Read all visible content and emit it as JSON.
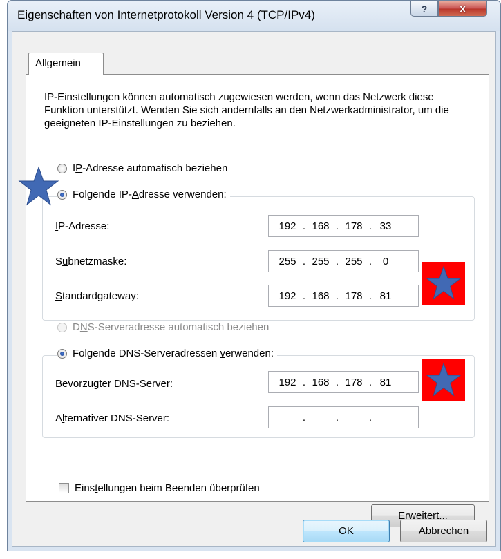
{
  "window": {
    "title": "Eigenschaften von Internetprotokoll Version 4 (TCP/IPv4)",
    "help_label": "?",
    "close_label": "X"
  },
  "tab": {
    "label": "Allgemein"
  },
  "intro_text": "IP-Einstellungen können automatisch zugewiesen werden, wenn das Netzwerk diese Funktion unterstützt. Wenden Sie sich andernfalls an den Netzwerkadministrator, um die geeigneten IP-Einstellungen zu beziehen.",
  "ip": {
    "auto_label": {
      "pre": "I",
      "key": "P",
      "post": "-Adresse automatisch beziehen"
    },
    "manual_label": {
      "pre": "Folgende IP-",
      "key": "A",
      "post": "dresse verwenden:"
    },
    "selected": "manual",
    "fields": [
      {
        "label": {
          "pre": "",
          "key": "I",
          "post": "P-Adresse:"
        },
        "octets": [
          "192",
          "168",
          "178",
          "33"
        ]
      },
      {
        "label": {
          "pre": "S",
          "key": "u",
          "post": "bnetzmaske:"
        },
        "octets": [
          "255",
          "255",
          "255",
          "0"
        ]
      },
      {
        "label": {
          "pre": "",
          "key": "S",
          "post": "tandardgateway:"
        },
        "octets": [
          "192",
          "168",
          "178",
          "81"
        ]
      }
    ]
  },
  "dns": {
    "auto_label": {
      "pre": "D",
      "key": "N",
      "post": "S-Serveradresse automatisch beziehen"
    },
    "manual_label": {
      "pre": "Folgende DNS-Serveradressen ",
      "key": "v",
      "post": "erwenden:"
    },
    "selected": "manual",
    "fields": [
      {
        "label": {
          "pre": "",
          "key": "B",
          "post": "evorzugter DNS-Server:"
        },
        "octets": [
          "192",
          "168",
          "178",
          "81"
        ]
      },
      {
        "label": {
          "pre": "A",
          "key": "l",
          "post": "ternativer DNS-Server:"
        },
        "octets": [
          "",
          "",
          "",
          ""
        ]
      }
    ]
  },
  "validate_checkbox": {
    "pre": "Eins",
    "key": "t",
    "post": "ellungen beim Beenden überprüfen",
    "checked": false
  },
  "advanced_button": {
    "pre": "",
    "key": "E",
    "post": "rweitert..."
  },
  "ok_label": "OK",
  "cancel_label": "Abbrechen",
  "colors": {
    "marker_red": "#ff0000",
    "star_blue": "#4169b4"
  }
}
